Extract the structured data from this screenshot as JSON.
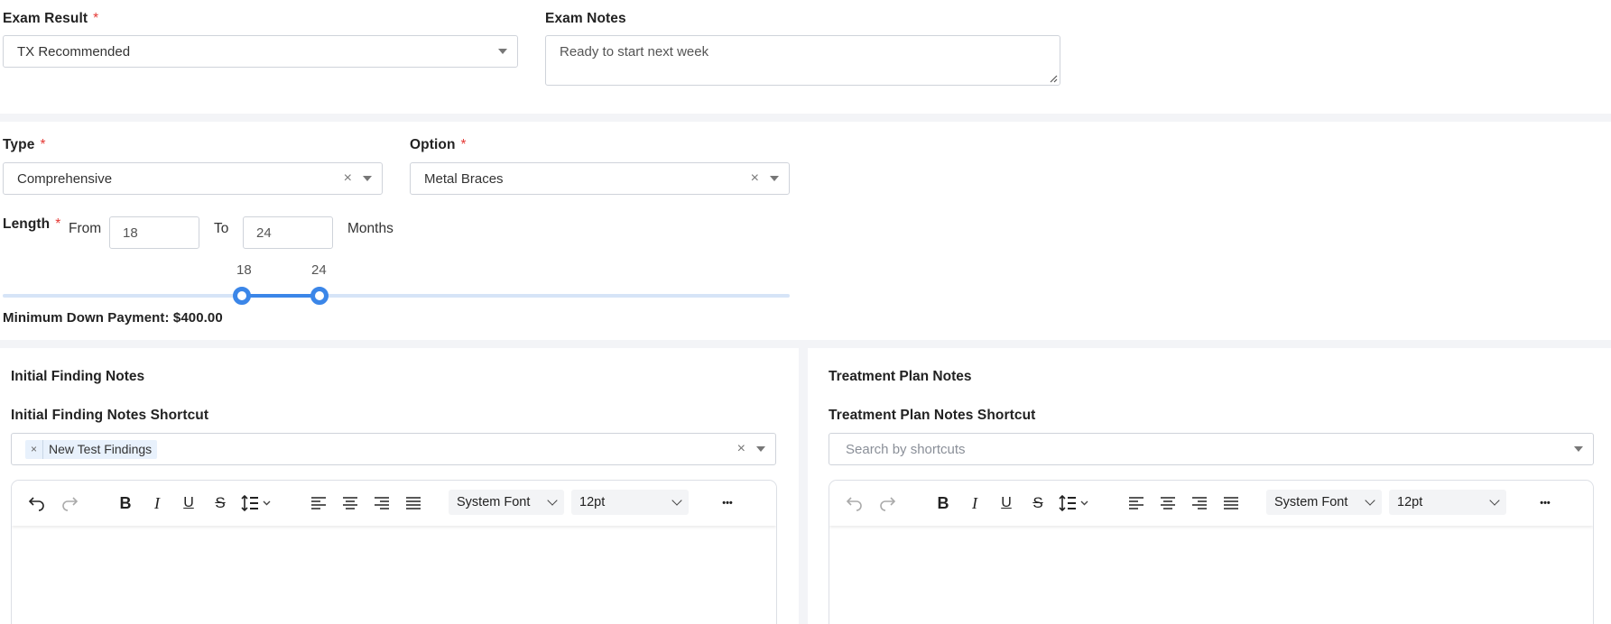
{
  "exam": {
    "result_label": "Exam Result",
    "result_value": "TX Recommended",
    "notes_label": "Exam Notes",
    "notes_value": "Ready to start next week"
  },
  "plan": {
    "type_label": "Type",
    "type_value": "Comprehensive",
    "option_label": "Option",
    "option_value": "Metal Braces",
    "length_label": "Length",
    "from_label": "From",
    "from_value": "18",
    "to_label": "To",
    "to_value": "24",
    "months_label": "Months",
    "slider": {
      "min_value": "18",
      "max_value": "24"
    },
    "down_payment": "Minimum Down Payment: $400.00"
  },
  "initial_notes": {
    "title": "Initial Finding Notes",
    "shortcut_label": "Initial Finding Notes Shortcut",
    "tag": "New Test Findings",
    "tag_remove": "×",
    "clear": "×"
  },
  "treatment_notes": {
    "title": "Treatment Plan Notes",
    "shortcut_label": "Treatment Plan Notes Shortcut",
    "placeholder": "Search by shortcuts"
  },
  "editor": {
    "font_family": "System Font",
    "font_size": "12pt",
    "more": "•••",
    "bold": "B",
    "italic": "I",
    "underline": "U",
    "strike": "S"
  },
  "common": {
    "required": "*",
    "clear": "×"
  },
  "colors": {
    "accent": "#3b86e8",
    "required": "#e53935"
  }
}
